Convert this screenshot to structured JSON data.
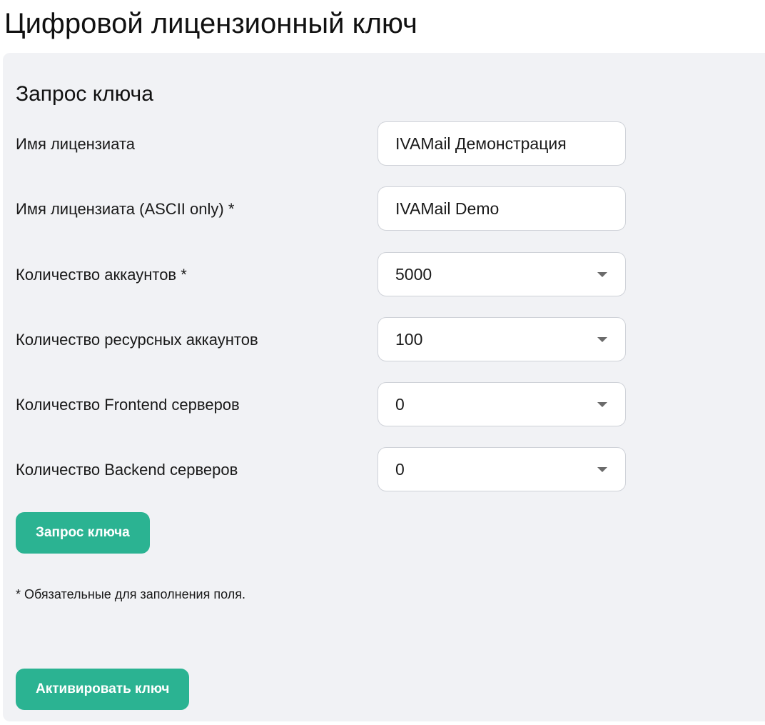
{
  "page": {
    "title": "Цифровой лицензионный ключ"
  },
  "request": {
    "section_title": "Запрос ключа",
    "fields": [
      {
        "label": "Имя лицензиата",
        "type": "input",
        "value": "IVAMail Демонстрация"
      },
      {
        "label": "Имя лицензиата (ASCII only) *",
        "type": "input",
        "value": "IVAMail Demo"
      },
      {
        "label": "Количество аккаунтов *",
        "type": "select",
        "value": "5000",
        "icon": "chevron-down-icon"
      },
      {
        "label": "Количество ресурсных аккаунтов",
        "type": "select",
        "value": "100",
        "icon": "chevron-down-icon"
      },
      {
        "label": "Количество Frontend серверов",
        "type": "select",
        "value": "0",
        "icon": "chevron-down-icon"
      },
      {
        "label": "Количество Backend серверов",
        "type": "select",
        "value": "0",
        "icon": "chevron-down-icon"
      }
    ],
    "request_button": "Запрос ключа",
    "required_note": "* Обязательные для заполнения поля.",
    "activate_button": "Активировать ключ"
  },
  "colors": {
    "accent": "#2bb392",
    "panel_background": "#f1f2f5",
    "field_border": "#cfd2d8",
    "text": "#1a1a1a"
  }
}
